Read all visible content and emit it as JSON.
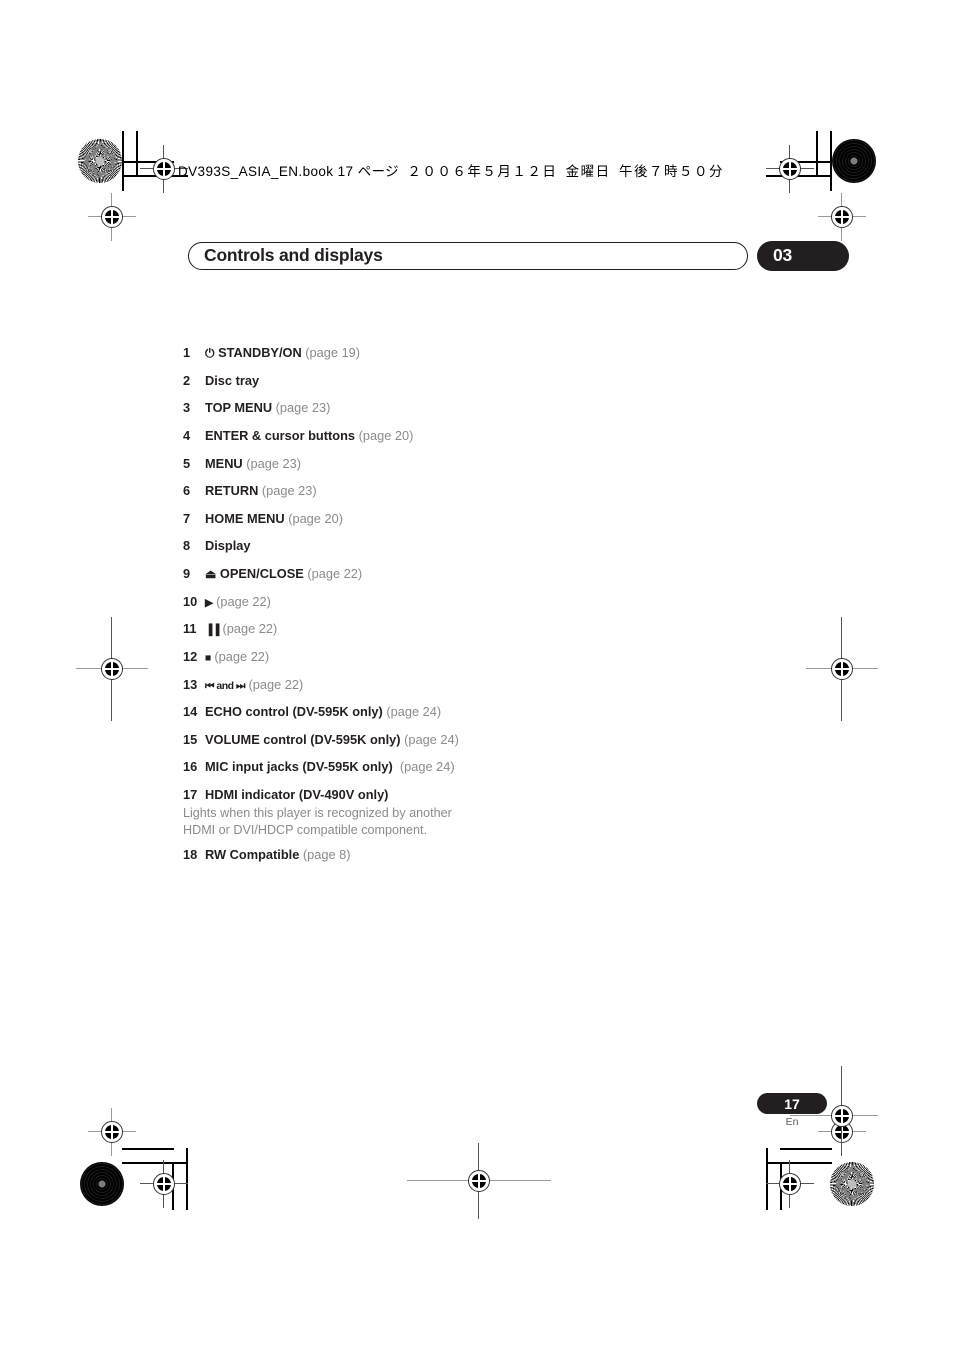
{
  "print_header": {
    "filename": "DV393S_ASIA_EN.book",
    "page_marker": "17 ページ",
    "date": "２００６年５月１２日",
    "weekday": "金曜日",
    "time": "午後７時５０分"
  },
  "header": {
    "title": "Controls and displays",
    "chapter": "03"
  },
  "list": [
    {
      "num": "1",
      "symbol": "⏻",
      "label": "STANDBY/ON",
      "pageref": "(page 19)",
      "desc": ""
    },
    {
      "num": "2",
      "symbol": "",
      "label": "Disc tray",
      "pageref": "",
      "desc": ""
    },
    {
      "num": "3",
      "symbol": "",
      "label": "TOP MENU",
      "pageref": "(page 23)",
      "desc": ""
    },
    {
      "num": "4",
      "symbol": "",
      "label": "ENTER & cursor buttons",
      "pageref": "(page 20)",
      "desc": ""
    },
    {
      "num": "5",
      "symbol": "",
      "label": "MENU",
      "pageref": "(page 23)",
      "desc": ""
    },
    {
      "num": "6",
      "symbol": "",
      "label": "RETURN",
      "pageref": "(page 23)",
      "desc": ""
    },
    {
      "num": "7",
      "symbol": "",
      "label": "HOME MENU",
      "pageref": "(page 20)",
      "desc": ""
    },
    {
      "num": "8",
      "symbol": "",
      "label": "Display",
      "pageref": "",
      "desc": ""
    },
    {
      "num": "9",
      "symbol": "⏏",
      "label": "OPEN/CLOSE",
      "pageref": "(page 22)",
      "desc": ""
    },
    {
      "num": "10",
      "symbol": "▶",
      "label": "",
      "pageref": "(page 22)",
      "desc": ""
    },
    {
      "num": "11",
      "symbol": "▐▐",
      "label": "",
      "pageref": "(page 22)",
      "desc": ""
    },
    {
      "num": "12",
      "symbol": "■",
      "label": "",
      "pageref": "(page 22)",
      "desc": ""
    },
    {
      "num": "13",
      "symbol": "⏮︎ and ⏭︎",
      "label": "",
      "pageref": "(page 22)",
      "desc": ""
    },
    {
      "num": "14",
      "symbol": "",
      "label": "ECHO control (DV-595K only)",
      "pageref": "(page 24)",
      "desc": ""
    },
    {
      "num": "15",
      "symbol": "",
      "label": "VOLUME control (DV-595K only)",
      "pageref": "(page 24)",
      "desc": ""
    },
    {
      "num": "16",
      "symbol": "",
      "label": "MIC input jacks (DV-595K only)",
      "pageref": "(page 24)",
      "desc": ""
    },
    {
      "num": "17",
      "symbol": "",
      "label": "HDMI indicator (DV-490V only)",
      "pageref": "",
      "desc": "Lights when this player is recognized by another HDMI or DVI/HDCP compatible component."
    },
    {
      "num": "18",
      "symbol": "",
      "label": "RW Compatible",
      "pageref": "(page 8)",
      "desc": ""
    }
  ],
  "footer": {
    "page_number": "17",
    "language": "En"
  },
  "colors": {
    "ink": "#231f20",
    "muted": "#8b8b8b",
    "paper": "#ffffff"
  }
}
